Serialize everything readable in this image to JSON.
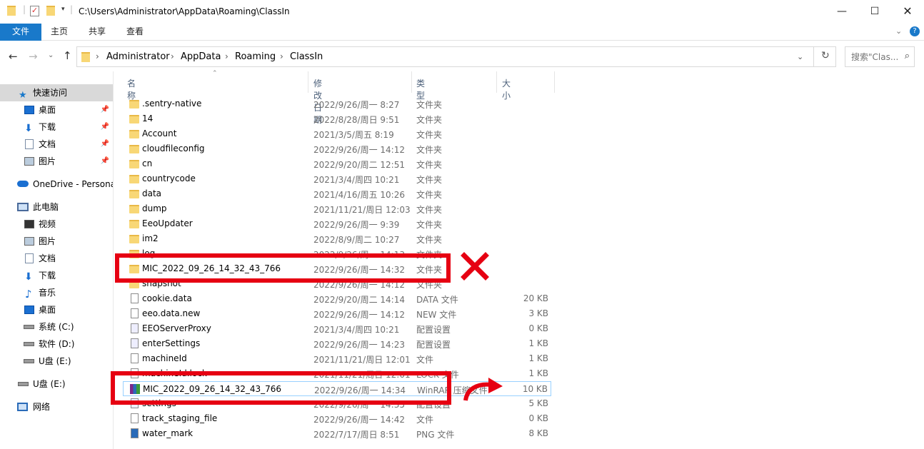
{
  "window": {
    "path": "C:\\Users\\Administrator\\AppData\\Roaming\\ClassIn"
  },
  "ribbon": {
    "tabs": [
      "文件",
      "主页",
      "共享",
      "查看"
    ]
  },
  "address": {
    "crumbs": [
      "Administrator",
      "AppData",
      "Roaming",
      "ClassIn"
    ]
  },
  "search": {
    "placeholder": "搜索\"Clas..."
  },
  "sidebar": {
    "items": [
      {
        "label": "快速访问"
      },
      {
        "label": "桌面"
      },
      {
        "label": "下载"
      },
      {
        "label": "文档"
      },
      {
        "label": "图片"
      },
      {
        "label": "OneDrive - Persona"
      },
      {
        "label": "此电脑"
      },
      {
        "label": "视频"
      },
      {
        "label": "图片"
      },
      {
        "label": "文档"
      },
      {
        "label": "下载"
      },
      {
        "label": "音乐"
      },
      {
        "label": "桌面"
      },
      {
        "label": "系统 (C:)"
      },
      {
        "label": "软件 (D:)"
      },
      {
        "label": "U盘 (E:)"
      },
      {
        "label": "U盘 (E:)"
      },
      {
        "label": "网络"
      }
    ]
  },
  "columns": {
    "name": "名称",
    "date": "修改日期",
    "type": "类型",
    "size": "大小"
  },
  "files": [
    {
      "name": ".sentry-native",
      "date": "2022/9/26/周一 8:27",
      "type": "文件夹",
      "size": ""
    },
    {
      "name": "14",
      "date": "2022/8/28/周日 9:51",
      "type": "文件夹",
      "size": ""
    },
    {
      "name": "Account",
      "date": "2021/3/5/周五 8:19",
      "type": "文件夹",
      "size": ""
    },
    {
      "name": "cloudfileconfig",
      "date": "2022/9/26/周一 14:12",
      "type": "文件夹",
      "size": ""
    },
    {
      "name": "cn",
      "date": "2022/9/20/周二 12:51",
      "type": "文件夹",
      "size": ""
    },
    {
      "name": "countrycode",
      "date": "2021/3/4/周四 10:21",
      "type": "文件夹",
      "size": ""
    },
    {
      "name": "data",
      "date": "2021/4/16/周五 10:26",
      "type": "文件夹",
      "size": ""
    },
    {
      "name": "dump",
      "date": "2021/11/21/周日 12:03",
      "type": "文件夹",
      "size": ""
    },
    {
      "name": "EeoUpdater",
      "date": "2022/9/26/周一 9:39",
      "type": "文件夹",
      "size": ""
    },
    {
      "name": "im2",
      "date": "2022/8/9/周二 10:27",
      "type": "文件夹",
      "size": ""
    },
    {
      "name": "log",
      "date": "2022/9/26/周一 14:13",
      "type": "文件夹",
      "size": ""
    },
    {
      "name": "MIC_2022_09_26_14_32_43_766",
      "date": "2022/9/26/周一 14:32",
      "type": "文件夹",
      "size": ""
    },
    {
      "name": "snapshot",
      "date": "2022/9/26/周一 14:12",
      "type": "文件夹",
      "size": ""
    },
    {
      "name": "cookie.data",
      "date": "2022/9/20/周二 14:14",
      "type": "DATA 文件",
      "size": "20 KB"
    },
    {
      "name": "eeo.data.new",
      "date": "2022/9/26/周一 14:12",
      "type": "NEW 文件",
      "size": "3 KB"
    },
    {
      "name": "EEOServerProxy",
      "date": "2021/3/4/周四 10:21",
      "type": "配置设置",
      "size": "0 KB"
    },
    {
      "name": "enterSettings",
      "date": "2022/9/26/周一 14:23",
      "type": "配置设置",
      "size": "1 KB"
    },
    {
      "name": "machineId",
      "date": "2021/11/21/周日 12:01",
      "type": "文件",
      "size": "1 KB"
    },
    {
      "name": "machineId.lock",
      "date": "2021/11/21/周日 12:01",
      "type": "LOCK 文件",
      "size": "1 KB"
    },
    {
      "name": "MIC_2022_09_26_14_32_43_766",
      "date": "2022/9/26/周一 14:34",
      "type": "WinRAR 压缩文件",
      "size": "10 KB"
    },
    {
      "name": "settings",
      "date": "2022/9/26/周一 14:35",
      "type": "配置设置",
      "size": "5 KB"
    },
    {
      "name": "track_staging_file",
      "date": "2022/9/26/周一 14:42",
      "type": "文件",
      "size": "0 KB"
    },
    {
      "name": "water_mark",
      "date": "2022/7/17/周日 8:51",
      "type": "PNG 文件",
      "size": "8 KB"
    }
  ],
  "colors": {
    "file_tab": "#1979ca",
    "annotation_red": "#e60012",
    "folder": "#f8d776"
  }
}
